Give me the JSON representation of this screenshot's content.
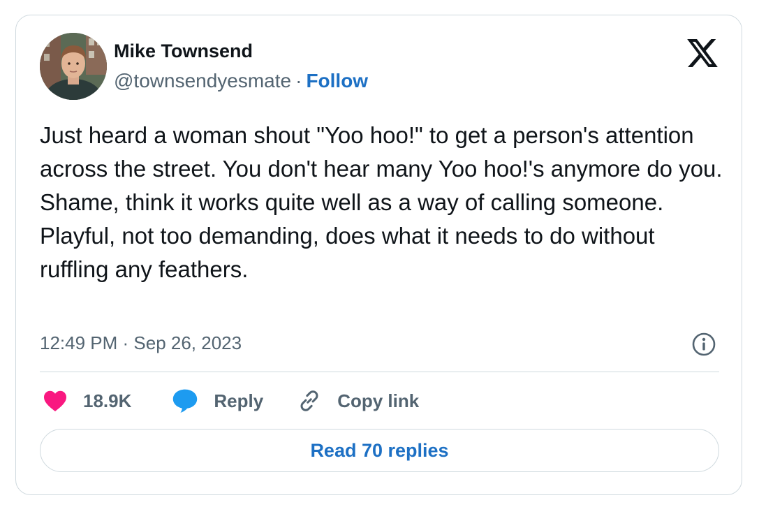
{
  "author": {
    "name": "Mike Townsend",
    "handle": "@townsendyesmate",
    "separator": "·",
    "follow_label": "Follow"
  },
  "tweet": {
    "text": "Just heard a woman shout \"Yoo hoo!\" to get a person's attention across the street. You don't hear many Yoo hoo!'s anymore do you. Shame, think it works quite well as a way of calling someone. Playful, not too demanding, does what it needs to do without ruffling any feathers.",
    "timestamp": "12:49 PM · Sep 26, 2023"
  },
  "actions": {
    "like_count": "18.9K",
    "reply_label": "Reply",
    "copy_link_label": "Copy link"
  },
  "footer": {
    "read_replies_label": "Read 70 replies"
  },
  "icons": {
    "brand": "x-logo-icon",
    "info": "info-icon",
    "like": "heart-icon",
    "reply": "speech-bubble-icon",
    "copy": "link-icon"
  },
  "colors": {
    "heart": "#f91880",
    "reply_bubble": "#1d9bf0",
    "link_blue": "#1d70c4",
    "secondary_text": "#536471",
    "border": "#cfd9de"
  }
}
